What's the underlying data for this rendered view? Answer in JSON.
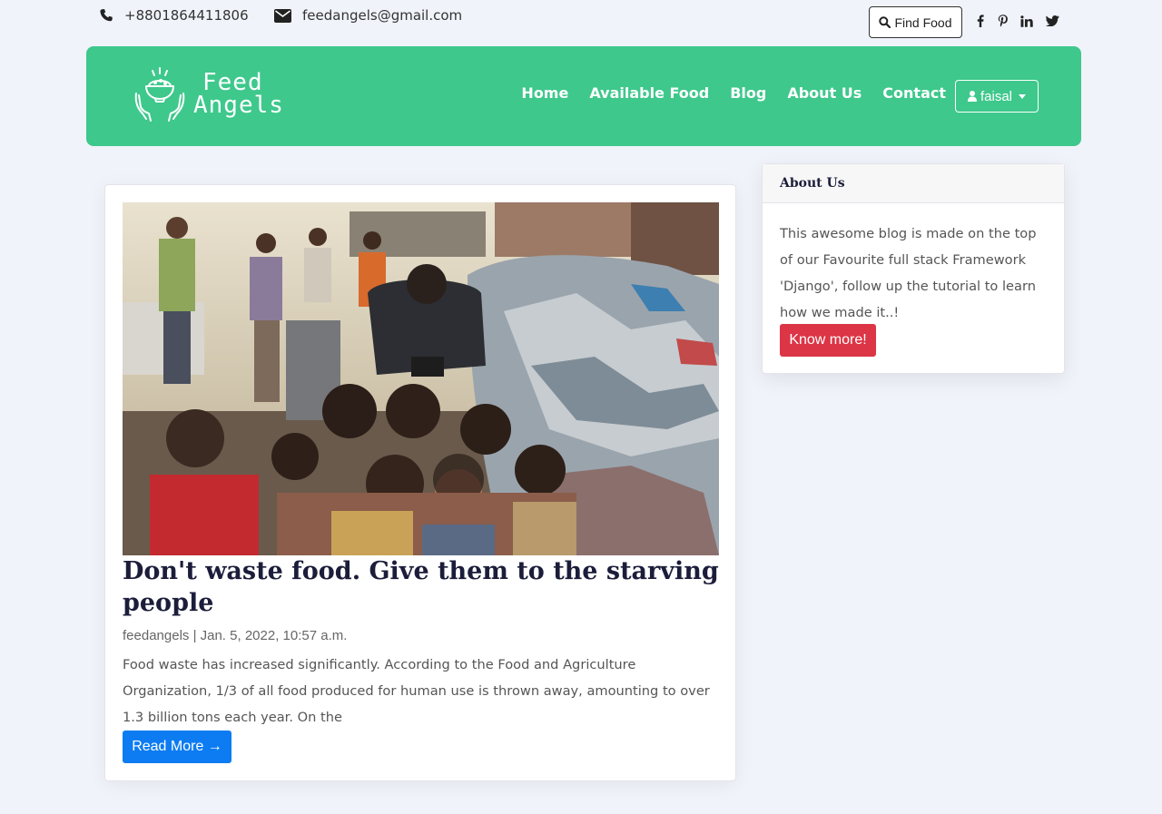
{
  "topbar": {
    "phone": "+8801864411806",
    "email": "feedangels@gmail.com",
    "find_food_label": "Find Food",
    "social_icons": [
      "facebook-icon",
      "pinterest-icon",
      "linkedin-icon",
      "twitter-icon"
    ]
  },
  "navbar": {
    "brand_line1": "Feed",
    "brand_line2": "Angels",
    "links": [
      "Home",
      "Available Food",
      "Blog",
      "About Us",
      "Contact"
    ],
    "user_label": "faisal",
    "bg_color": "#3ec88c"
  },
  "post": {
    "title": "Don't waste food. Give them to the starving people",
    "meta": "feedangels | Jan. 5, 2022, 10:57 a.m.",
    "excerpt": "Food waste has increased significantly. According to the Food and Agriculture Organization, 1/3 of all food produced for human use is thrown away, amounting to over 1.3 billion tons each year. On the",
    "read_more_label": "Read More →",
    "read_more_color": "#0d7cf2"
  },
  "sidebar": {
    "header": "About Us",
    "body": "This awesome blog is made on the top of our Favourite full stack Framework 'Django', follow up the tutorial to learn how we made it..!",
    "button_label": "Know more!",
    "button_color": "#dc3545"
  }
}
